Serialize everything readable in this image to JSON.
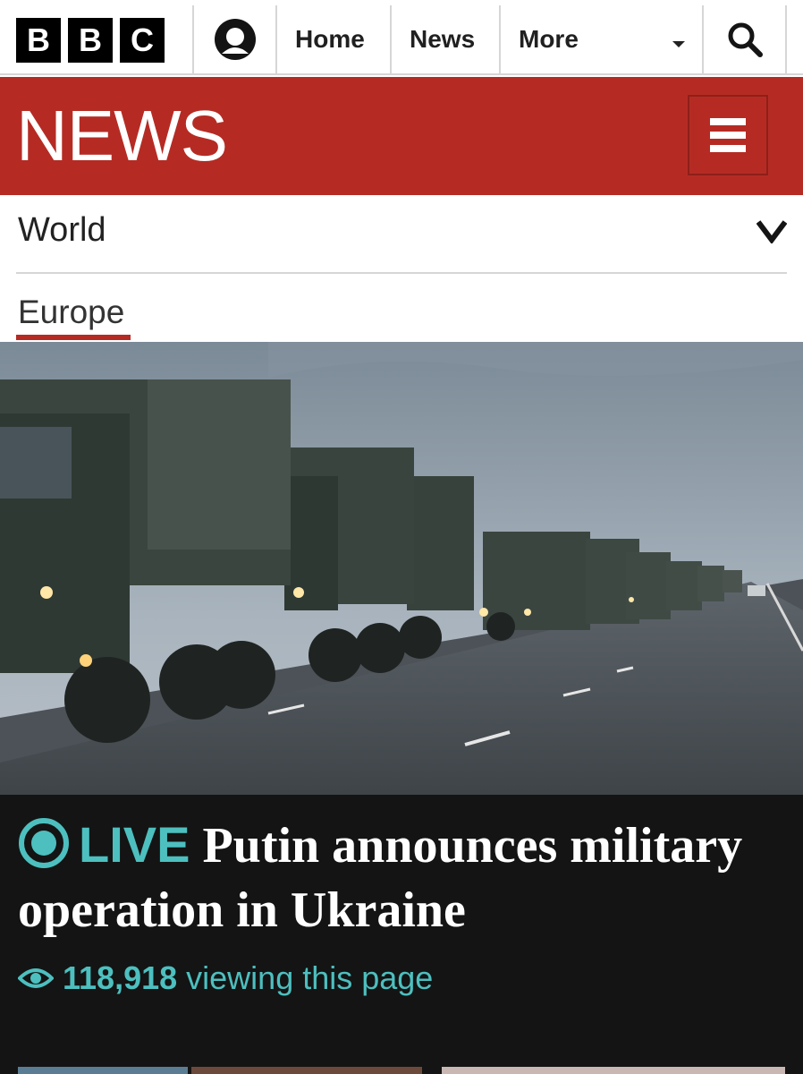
{
  "top_nav": {
    "logo_letters": [
      "B",
      "B",
      "C"
    ],
    "account_icon": "user-account-icon",
    "items": [
      {
        "label": "Home"
      },
      {
        "label": "News"
      },
      {
        "label": "More"
      }
    ],
    "more_icon": "caret-down-icon",
    "search_icon": "search-icon"
  },
  "banner": {
    "title": "NEWS",
    "menu_icon": "hamburger-menu-icon",
    "color": "#b52b24"
  },
  "section": {
    "label": "World",
    "chevron_icon": "chevron-down-icon",
    "subsection": "Europe"
  },
  "hero_image": {
    "alt": "photo-of-military-truck-convoy-on-road"
  },
  "headline": {
    "live_icon": "live-indicator-icon",
    "live_label": "LIVE",
    "title": "Putin announces military operation in Ukraine",
    "viewer_icon": "eye-icon",
    "viewer_count": "118,918",
    "viewer_text": "viewing this page",
    "accent_color": "#4dbfbf"
  }
}
